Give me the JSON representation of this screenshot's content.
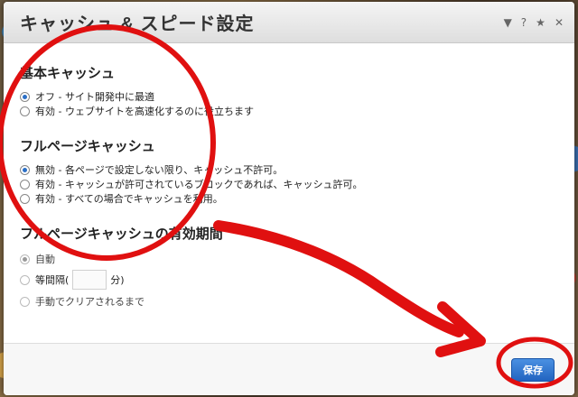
{
  "modal": {
    "title": "キャッシュ & スピード設定",
    "header_icons": [
      "chevron-down-icon",
      "help-icon",
      "star-icon",
      "close-icon"
    ],
    "header_icon_glyphs": [
      "▼",
      "?",
      "★",
      "✕"
    ]
  },
  "basic_cache": {
    "heading": "基本キャッシュ",
    "options": [
      {
        "label": "オフ - サイト開発中に最適",
        "checked": true
      },
      {
        "label": "有効 - ウェブサイトを高速化するのに役立ちます",
        "checked": false
      }
    ]
  },
  "full_page_cache": {
    "heading": "フルページキャッシュ",
    "options": [
      {
        "label": "無効 - 各ページで設定しない限り、キャッシュ不許可。",
        "checked": true
      },
      {
        "label": "有効 - キャッシュが許可されているブロックであれば、キャッシュ許可。",
        "checked": false
      },
      {
        "label": "有効 - すべての場合でキャッシュを利用。",
        "checked": false
      }
    ]
  },
  "full_page_expiry": {
    "heading": "フルページキャッシュの有効期間",
    "options": {
      "auto": "自動",
      "interval_prefix": "等間隔(",
      "interval_value": "",
      "interval_suffix": "分)",
      "manual": "手動でクリアされるまで"
    }
  },
  "footer": {
    "save_label": "保存"
  },
  "colors": {
    "accent": "#2b6fc6",
    "annotation": "#e01010"
  }
}
